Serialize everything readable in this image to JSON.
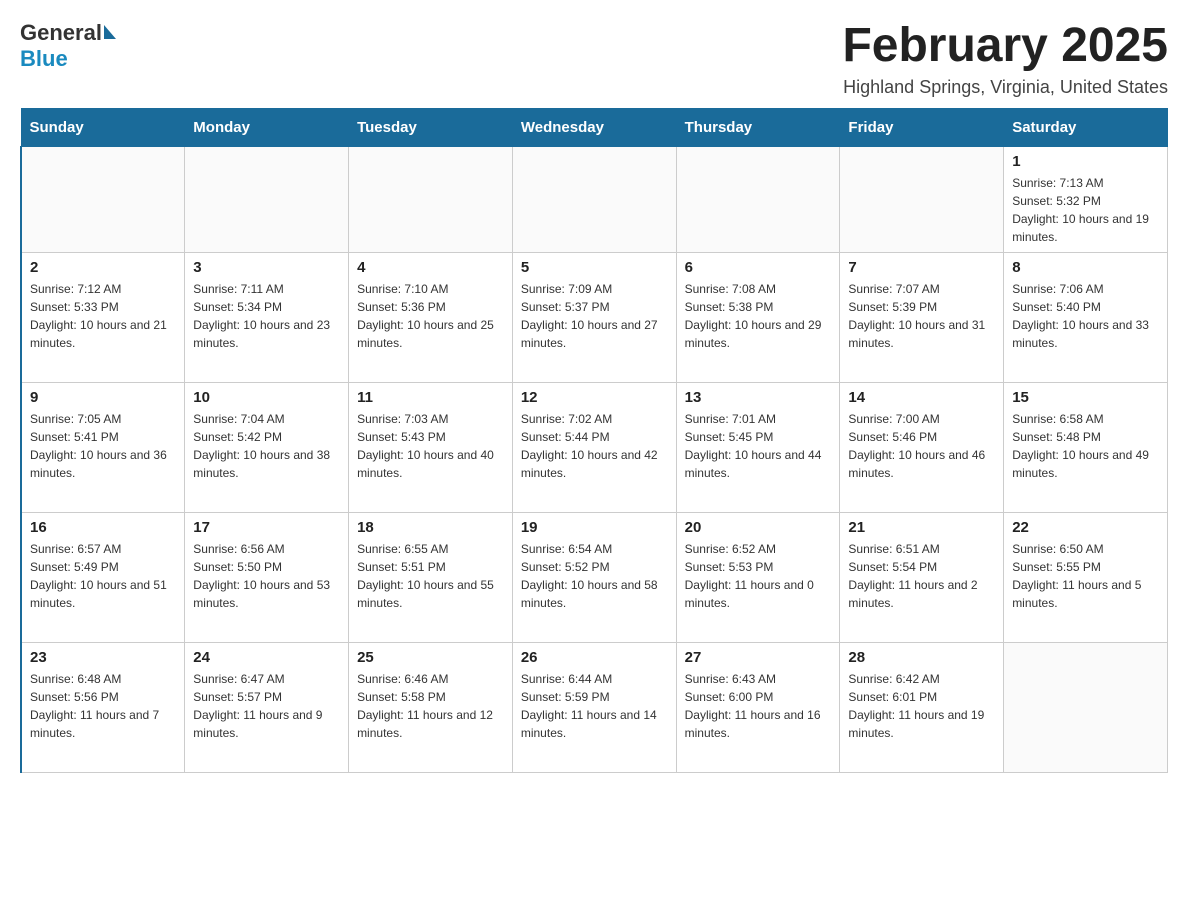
{
  "header": {
    "logo_text_general": "General",
    "logo_text_blue": "Blue",
    "title": "February 2025",
    "subtitle": "Highland Springs, Virginia, United States"
  },
  "days_of_week": [
    "Sunday",
    "Monday",
    "Tuesday",
    "Wednesday",
    "Thursday",
    "Friday",
    "Saturday"
  ],
  "weeks": [
    [
      {
        "day": "",
        "info": ""
      },
      {
        "day": "",
        "info": ""
      },
      {
        "day": "",
        "info": ""
      },
      {
        "day": "",
        "info": ""
      },
      {
        "day": "",
        "info": ""
      },
      {
        "day": "",
        "info": ""
      },
      {
        "day": "1",
        "info": "Sunrise: 7:13 AM\nSunset: 5:32 PM\nDaylight: 10 hours and 19 minutes."
      }
    ],
    [
      {
        "day": "2",
        "info": "Sunrise: 7:12 AM\nSunset: 5:33 PM\nDaylight: 10 hours and 21 minutes."
      },
      {
        "day": "3",
        "info": "Sunrise: 7:11 AM\nSunset: 5:34 PM\nDaylight: 10 hours and 23 minutes."
      },
      {
        "day": "4",
        "info": "Sunrise: 7:10 AM\nSunset: 5:36 PM\nDaylight: 10 hours and 25 minutes."
      },
      {
        "day": "5",
        "info": "Sunrise: 7:09 AM\nSunset: 5:37 PM\nDaylight: 10 hours and 27 minutes."
      },
      {
        "day": "6",
        "info": "Sunrise: 7:08 AM\nSunset: 5:38 PM\nDaylight: 10 hours and 29 minutes."
      },
      {
        "day": "7",
        "info": "Sunrise: 7:07 AM\nSunset: 5:39 PM\nDaylight: 10 hours and 31 minutes."
      },
      {
        "day": "8",
        "info": "Sunrise: 7:06 AM\nSunset: 5:40 PM\nDaylight: 10 hours and 33 minutes."
      }
    ],
    [
      {
        "day": "9",
        "info": "Sunrise: 7:05 AM\nSunset: 5:41 PM\nDaylight: 10 hours and 36 minutes."
      },
      {
        "day": "10",
        "info": "Sunrise: 7:04 AM\nSunset: 5:42 PM\nDaylight: 10 hours and 38 minutes."
      },
      {
        "day": "11",
        "info": "Sunrise: 7:03 AM\nSunset: 5:43 PM\nDaylight: 10 hours and 40 minutes."
      },
      {
        "day": "12",
        "info": "Sunrise: 7:02 AM\nSunset: 5:44 PM\nDaylight: 10 hours and 42 minutes."
      },
      {
        "day": "13",
        "info": "Sunrise: 7:01 AM\nSunset: 5:45 PM\nDaylight: 10 hours and 44 minutes."
      },
      {
        "day": "14",
        "info": "Sunrise: 7:00 AM\nSunset: 5:46 PM\nDaylight: 10 hours and 46 minutes."
      },
      {
        "day": "15",
        "info": "Sunrise: 6:58 AM\nSunset: 5:48 PM\nDaylight: 10 hours and 49 minutes."
      }
    ],
    [
      {
        "day": "16",
        "info": "Sunrise: 6:57 AM\nSunset: 5:49 PM\nDaylight: 10 hours and 51 minutes."
      },
      {
        "day": "17",
        "info": "Sunrise: 6:56 AM\nSunset: 5:50 PM\nDaylight: 10 hours and 53 minutes."
      },
      {
        "day": "18",
        "info": "Sunrise: 6:55 AM\nSunset: 5:51 PM\nDaylight: 10 hours and 55 minutes."
      },
      {
        "day": "19",
        "info": "Sunrise: 6:54 AM\nSunset: 5:52 PM\nDaylight: 10 hours and 58 minutes."
      },
      {
        "day": "20",
        "info": "Sunrise: 6:52 AM\nSunset: 5:53 PM\nDaylight: 11 hours and 0 minutes."
      },
      {
        "day": "21",
        "info": "Sunrise: 6:51 AM\nSunset: 5:54 PM\nDaylight: 11 hours and 2 minutes."
      },
      {
        "day": "22",
        "info": "Sunrise: 6:50 AM\nSunset: 5:55 PM\nDaylight: 11 hours and 5 minutes."
      }
    ],
    [
      {
        "day": "23",
        "info": "Sunrise: 6:48 AM\nSunset: 5:56 PM\nDaylight: 11 hours and 7 minutes."
      },
      {
        "day": "24",
        "info": "Sunrise: 6:47 AM\nSunset: 5:57 PM\nDaylight: 11 hours and 9 minutes."
      },
      {
        "day": "25",
        "info": "Sunrise: 6:46 AM\nSunset: 5:58 PM\nDaylight: 11 hours and 12 minutes."
      },
      {
        "day": "26",
        "info": "Sunrise: 6:44 AM\nSunset: 5:59 PM\nDaylight: 11 hours and 14 minutes."
      },
      {
        "day": "27",
        "info": "Sunrise: 6:43 AM\nSunset: 6:00 PM\nDaylight: 11 hours and 16 minutes."
      },
      {
        "day": "28",
        "info": "Sunrise: 6:42 AM\nSunset: 6:01 PM\nDaylight: 11 hours and 19 minutes."
      },
      {
        "day": "",
        "info": ""
      }
    ]
  ]
}
